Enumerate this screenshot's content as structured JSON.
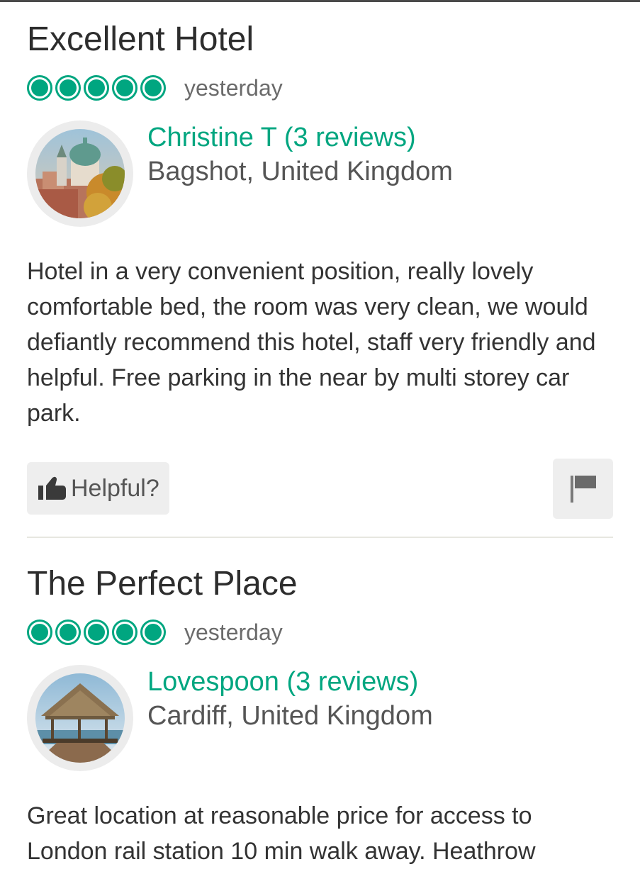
{
  "reviews": [
    {
      "title": "Excellent Hotel",
      "rating": 5,
      "rating_max": 5,
      "date": "yesterday",
      "reviewer_name": "Christine T (3 reviews)",
      "reviewer_location": "Bagshot, United Kingdom",
      "body": "Hotel in a very convenient position, really lovely comfortable bed, the room was very clean, we would defiantly recommend this hotel, staff very friendly and helpful. Free parking in the near by multi storey car park.",
      "helpful_label": "Helpful?",
      "helpful_icon": "thumbs-up-icon",
      "flag_icon": "flag-icon"
    },
    {
      "title": "The Perfect Place",
      "rating": 5,
      "rating_max": 5,
      "date": "yesterday",
      "reviewer_name": "Lovespoon (3 reviews)",
      "reviewer_location": "Cardiff, United Kingdom",
      "body": "Great location at reasonable price for access to London rail station 10 min walk away. Heathrow"
    }
  ],
  "colors": {
    "accent": "#00a680",
    "text": "#333333",
    "muted": "#6b6b6b",
    "button_bg": "#eeeeee"
  }
}
